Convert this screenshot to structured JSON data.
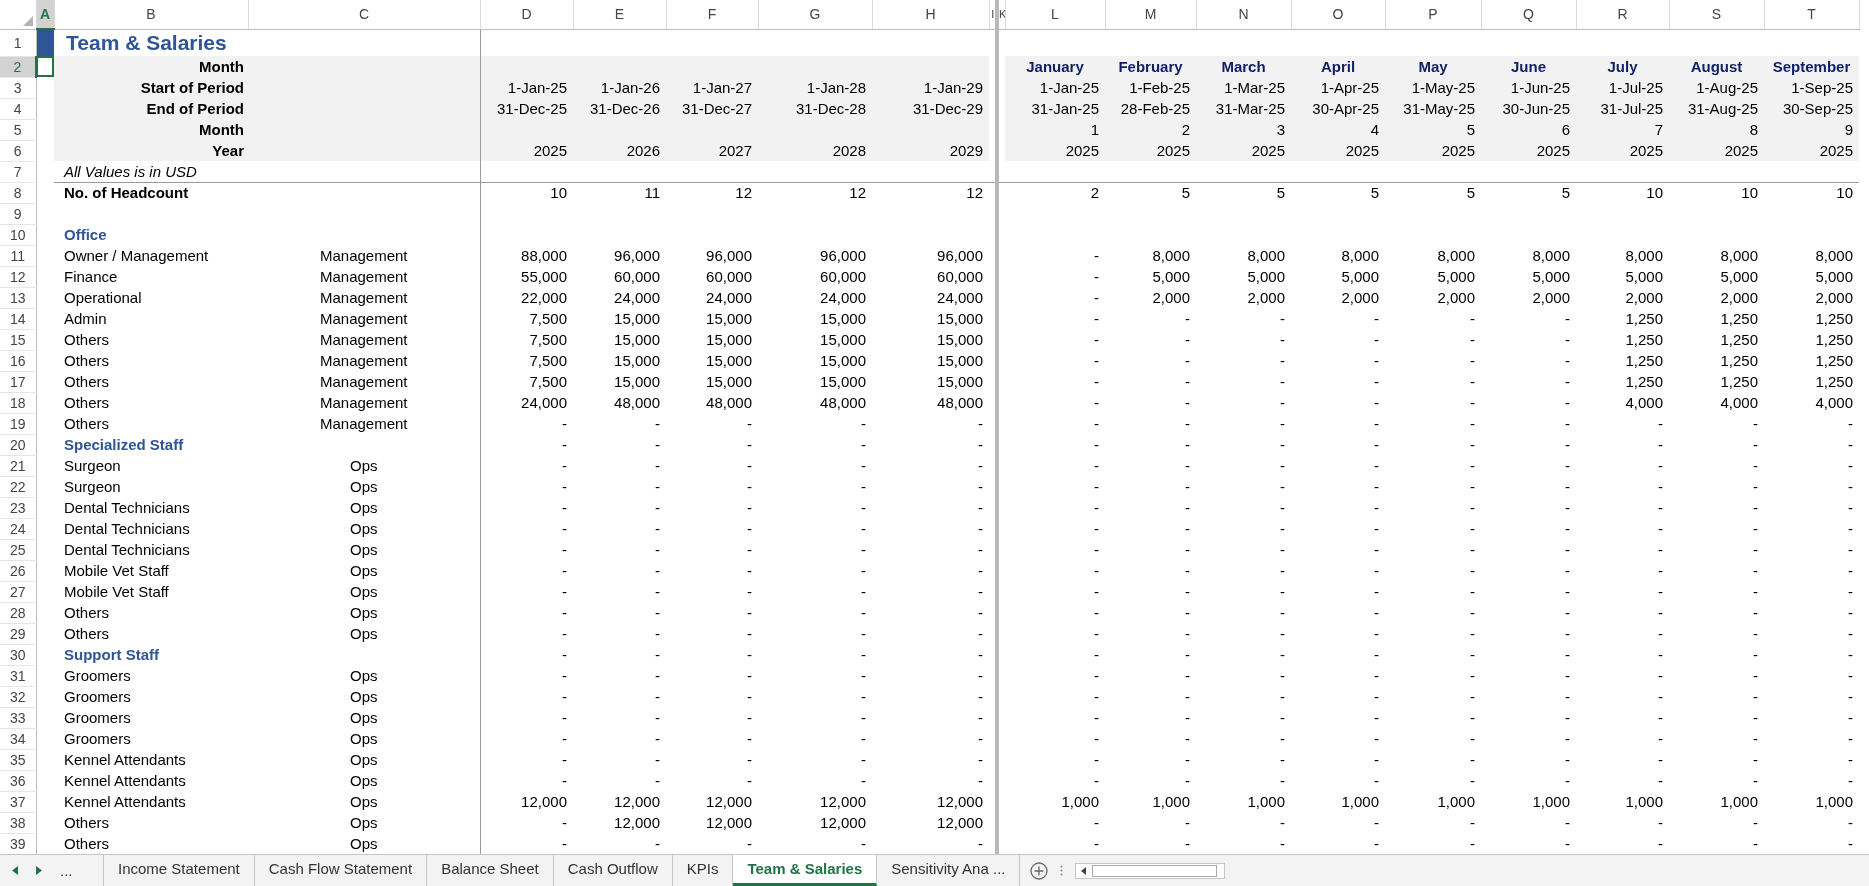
{
  "columns": [
    {
      "letter": "A",
      "selected": true
    },
    {
      "letter": "B",
      "selected": false
    },
    {
      "letter": "C",
      "selected": false
    },
    {
      "letter": "D",
      "selected": false
    },
    {
      "letter": "E",
      "selected": false
    },
    {
      "letter": "F",
      "selected": false
    },
    {
      "letter": "G",
      "selected": false
    },
    {
      "letter": "H",
      "selected": false
    },
    {
      "letter": "I",
      "selected": false
    },
    {
      "letter": "K",
      "selected": false
    },
    {
      "letter": "L",
      "selected": false
    },
    {
      "letter": "M",
      "selected": false
    },
    {
      "letter": "N",
      "selected": false
    },
    {
      "letter": "O",
      "selected": false
    },
    {
      "letter": "P",
      "selected": false
    },
    {
      "letter": "Q",
      "selected": false
    },
    {
      "letter": "R",
      "selected": false
    },
    {
      "letter": "S",
      "selected": false
    },
    {
      "letter": "T",
      "selected": false
    }
  ],
  "rows": [
    {
      "num": "1",
      "kind": "title",
      "selected": false,
      "b": "Team & Salaries"
    },
    {
      "num": "2",
      "kind": "period_names",
      "selected": true,
      "b": "Month",
      "monthly": [
        "January",
        "February",
        "March",
        "April",
        "May",
        "June",
        "July",
        "August",
        "September"
      ]
    },
    {
      "num": "3",
      "kind": "period",
      "selected": false,
      "b": "Start of Period",
      "annual": [
        "1-Jan-25",
        "1-Jan-26",
        "1-Jan-27",
        "1-Jan-28",
        "1-Jan-29"
      ],
      "monthly": [
        "1-Jan-25",
        "1-Feb-25",
        "1-Mar-25",
        "1-Apr-25",
        "1-May-25",
        "1-Jun-25",
        "1-Jul-25",
        "1-Aug-25",
        "1-Sep-25"
      ]
    },
    {
      "num": "4",
      "kind": "period",
      "selected": false,
      "b": "End of Period",
      "annual": [
        "31-Dec-25",
        "31-Dec-26",
        "31-Dec-27",
        "31-Dec-28",
        "31-Dec-29"
      ],
      "monthly": [
        "31-Jan-25",
        "28-Feb-25",
        "31-Mar-25",
        "30-Apr-25",
        "31-May-25",
        "30-Jun-25",
        "31-Jul-25",
        "31-Aug-25",
        "30-Sep-25"
      ]
    },
    {
      "num": "5",
      "kind": "period",
      "selected": false,
      "b": "Month",
      "monthly": [
        "1",
        "2",
        "3",
        "4",
        "5",
        "6",
        "7",
        "8",
        "9"
      ]
    },
    {
      "num": "6",
      "kind": "period",
      "selected": false,
      "b": "Year",
      "annual": [
        "2025",
        "2026",
        "2027",
        "2028",
        "2029"
      ],
      "monthly": [
        "2025",
        "2025",
        "2025",
        "2025",
        "2025",
        "2025",
        "2025",
        "2025",
        "2025"
      ]
    },
    {
      "num": "7",
      "kind": "note",
      "selected": false,
      "b": "All Values is in USD"
    },
    {
      "num": "8",
      "kind": "total",
      "selected": false,
      "b": "No. of Headcount",
      "annual": [
        "10",
        "11",
        "12",
        "12",
        "12"
      ],
      "monthly": [
        "2",
        "5",
        "5",
        "5",
        "5",
        "5",
        "10",
        "10",
        "10"
      ]
    },
    {
      "num": "9",
      "kind": "blank",
      "selected": false
    },
    {
      "num": "10",
      "kind": "section",
      "selected": false,
      "b": "Office"
    },
    {
      "num": "11",
      "kind": "item",
      "selected": false,
      "b": "Owner / Management",
      "c": "Management",
      "annual": [
        "88,000",
        "96,000",
        "96,000",
        "96,000",
        "96,000"
      ],
      "monthly": [
        "-",
        "8,000",
        "8,000",
        "8,000",
        "8,000",
        "8,000",
        "8,000",
        "8,000",
        "8,000"
      ]
    },
    {
      "num": "12",
      "kind": "item",
      "selected": false,
      "b": "Finance",
      "c": "Management",
      "annual": [
        "55,000",
        "60,000",
        "60,000",
        "60,000",
        "60,000"
      ],
      "monthly": [
        "-",
        "5,000",
        "5,000",
        "5,000",
        "5,000",
        "5,000",
        "5,000",
        "5,000",
        "5,000"
      ]
    },
    {
      "num": "13",
      "kind": "item",
      "selected": false,
      "b": "Operational",
      "c": "Management",
      "annual": [
        "22,000",
        "24,000",
        "24,000",
        "24,000",
        "24,000"
      ],
      "monthly": [
        "-",
        "2,000",
        "2,000",
        "2,000",
        "2,000",
        "2,000",
        "2,000",
        "2,000",
        "2,000"
      ]
    },
    {
      "num": "14",
      "kind": "item",
      "selected": false,
      "b": "Admin",
      "c": "Management",
      "annual": [
        "7,500",
        "15,000",
        "15,000",
        "15,000",
        "15,000"
      ],
      "monthly": [
        "-",
        "-",
        "-",
        "-",
        "-",
        "-",
        "1,250",
        "1,250",
        "1,250"
      ]
    },
    {
      "num": "15",
      "kind": "item",
      "selected": false,
      "b": "Others",
      "c": "Management",
      "annual": [
        "7,500",
        "15,000",
        "15,000",
        "15,000",
        "15,000"
      ],
      "monthly": [
        "-",
        "-",
        "-",
        "-",
        "-",
        "-",
        "1,250",
        "1,250",
        "1,250"
      ]
    },
    {
      "num": "16",
      "kind": "item",
      "selected": false,
      "b": "Others",
      "c": "Management",
      "annual": [
        "7,500",
        "15,000",
        "15,000",
        "15,000",
        "15,000"
      ],
      "monthly": [
        "-",
        "-",
        "-",
        "-",
        "-",
        "-",
        "1,250",
        "1,250",
        "1,250"
      ]
    },
    {
      "num": "17",
      "kind": "item",
      "selected": false,
      "b": "Others",
      "c": "Management",
      "annual": [
        "7,500",
        "15,000",
        "15,000",
        "15,000",
        "15,000"
      ],
      "monthly": [
        "-",
        "-",
        "-",
        "-",
        "-",
        "-",
        "1,250",
        "1,250",
        "1,250"
      ]
    },
    {
      "num": "18",
      "kind": "item",
      "selected": false,
      "b": "Others",
      "c": "Management",
      "annual": [
        "24,000",
        "48,000",
        "48,000",
        "48,000",
        "48,000"
      ],
      "monthly": [
        "-",
        "-",
        "-",
        "-",
        "-",
        "-",
        "4,000",
        "4,000",
        "4,000"
      ]
    },
    {
      "num": "19",
      "kind": "item",
      "selected": false,
      "b": "Others",
      "c": "Management",
      "annual": [
        "-",
        "-",
        "-",
        "-",
        "-"
      ],
      "monthly": [
        "-",
        "-",
        "-",
        "-",
        "-",
        "-",
        "-",
        "-",
        "-"
      ]
    },
    {
      "num": "20",
      "kind": "section",
      "selected": false,
      "b": "Specialized Staff",
      "annual": [
        "-",
        "-",
        "-",
        "-",
        "-"
      ],
      "monthly": [
        "-",
        "-",
        "-",
        "-",
        "-",
        "-",
        "-",
        "-",
        "-"
      ]
    },
    {
      "num": "21",
      "kind": "item",
      "selected": false,
      "b": "Surgeon",
      "c": "Ops",
      "annual": [
        "-",
        "-",
        "-",
        "-",
        "-"
      ],
      "monthly": [
        "-",
        "-",
        "-",
        "-",
        "-",
        "-",
        "-",
        "-",
        "-"
      ]
    },
    {
      "num": "22",
      "kind": "item",
      "selected": false,
      "b": "Surgeon",
      "c": "Ops",
      "annual": [
        "-",
        "-",
        "-",
        "-",
        "-"
      ],
      "monthly": [
        "-",
        "-",
        "-",
        "-",
        "-",
        "-",
        "-",
        "-",
        "-"
      ]
    },
    {
      "num": "23",
      "kind": "item",
      "selected": false,
      "b": "Dental Technicians",
      "c": "Ops",
      "annual": [
        "-",
        "-",
        "-",
        "-",
        "-"
      ],
      "monthly": [
        "-",
        "-",
        "-",
        "-",
        "-",
        "-",
        "-",
        "-",
        "-"
      ]
    },
    {
      "num": "24",
      "kind": "item",
      "selected": false,
      "b": "Dental Technicians",
      "c": "Ops",
      "annual": [
        "-",
        "-",
        "-",
        "-",
        "-"
      ],
      "monthly": [
        "-",
        "-",
        "-",
        "-",
        "-",
        "-",
        "-",
        "-",
        "-"
      ]
    },
    {
      "num": "25",
      "kind": "item",
      "selected": false,
      "b": "Dental Technicians",
      "c": "Ops",
      "annual": [
        "-",
        "-",
        "-",
        "-",
        "-"
      ],
      "monthly": [
        "-",
        "-",
        "-",
        "-",
        "-",
        "-",
        "-",
        "-",
        "-"
      ]
    },
    {
      "num": "26",
      "kind": "item",
      "selected": false,
      "b": "Mobile Vet Staff",
      "c": "Ops",
      "annual": [
        "-",
        "-",
        "-",
        "-",
        "-"
      ],
      "monthly": [
        "-",
        "-",
        "-",
        "-",
        "-",
        "-",
        "-",
        "-",
        "-"
      ]
    },
    {
      "num": "27",
      "kind": "item",
      "selected": false,
      "b": "Mobile Vet Staff",
      "c": "Ops",
      "annual": [
        "-",
        "-",
        "-",
        "-",
        "-"
      ],
      "monthly": [
        "-",
        "-",
        "-",
        "-",
        "-",
        "-",
        "-",
        "-",
        "-"
      ]
    },
    {
      "num": "28",
      "kind": "item",
      "selected": false,
      "b": "Others",
      "c": "Ops",
      "annual": [
        "-",
        "-",
        "-",
        "-",
        "-"
      ],
      "monthly": [
        "-",
        "-",
        "-",
        "-",
        "-",
        "-",
        "-",
        "-",
        "-"
      ]
    },
    {
      "num": "29",
      "kind": "item",
      "selected": false,
      "b": "Others",
      "c": "Ops",
      "annual": [
        "-",
        "-",
        "-",
        "-",
        "-"
      ],
      "monthly": [
        "-",
        "-",
        "-",
        "-",
        "-",
        "-",
        "-",
        "-",
        "-"
      ]
    },
    {
      "num": "30",
      "kind": "section",
      "selected": false,
      "b": "Support Staff",
      "annual": [
        "-",
        "-",
        "-",
        "-",
        "-"
      ],
      "monthly": [
        "-",
        "-",
        "-",
        "-",
        "-",
        "-",
        "-",
        "-",
        "-"
      ]
    },
    {
      "num": "31",
      "kind": "item",
      "selected": false,
      "b": "Groomers",
      "c": "Ops",
      "annual": [
        "-",
        "-",
        "-",
        "-",
        "-"
      ],
      "monthly": [
        "-",
        "-",
        "-",
        "-",
        "-",
        "-",
        "-",
        "-",
        "-"
      ]
    },
    {
      "num": "32",
      "kind": "item",
      "selected": false,
      "b": "Groomers",
      "c": "Ops",
      "annual": [
        "-",
        "-",
        "-",
        "-",
        "-"
      ],
      "monthly": [
        "-",
        "-",
        "-",
        "-",
        "-",
        "-",
        "-",
        "-",
        "-"
      ]
    },
    {
      "num": "33",
      "kind": "item",
      "selected": false,
      "b": "Groomers",
      "c": "Ops",
      "annual": [
        "-",
        "-",
        "-",
        "-",
        "-"
      ],
      "monthly": [
        "-",
        "-",
        "-",
        "-",
        "-",
        "-",
        "-",
        "-",
        "-"
      ]
    },
    {
      "num": "34",
      "kind": "item",
      "selected": false,
      "b": "Groomers",
      "c": "Ops",
      "annual": [
        "-",
        "-",
        "-",
        "-",
        "-"
      ],
      "monthly": [
        "-",
        "-",
        "-",
        "-",
        "-",
        "-",
        "-",
        "-",
        "-"
      ]
    },
    {
      "num": "35",
      "kind": "item",
      "selected": false,
      "b": "Kennel Attendants",
      "c": "Ops",
      "annual": [
        "-",
        "-",
        "-",
        "-",
        "-"
      ],
      "monthly": [
        "-",
        "-",
        "-",
        "-",
        "-",
        "-",
        "-",
        "-",
        "-"
      ]
    },
    {
      "num": "36",
      "kind": "item",
      "selected": false,
      "b": "Kennel Attendants",
      "c": "Ops",
      "annual": [
        "-",
        "-",
        "-",
        "-",
        "-"
      ],
      "monthly": [
        "-",
        "-",
        "-",
        "-",
        "-",
        "-",
        "-",
        "-",
        "-"
      ]
    },
    {
      "num": "37",
      "kind": "item",
      "selected": false,
      "b": "Kennel Attendants",
      "c": "Ops",
      "annual": [
        "12,000",
        "12,000",
        "12,000",
        "12,000",
        "12,000"
      ],
      "monthly": [
        "1,000",
        "1,000",
        "1,000",
        "1,000",
        "1,000",
        "1,000",
        "1,000",
        "1,000",
        "1,000"
      ]
    },
    {
      "num": "38",
      "kind": "item",
      "selected": false,
      "b": "Others",
      "c": "Ops",
      "annual": [
        "-",
        "12,000",
        "12,000",
        "12,000",
        "12,000"
      ],
      "monthly": [
        "-",
        "-",
        "-",
        "-",
        "-",
        "-",
        "-",
        "-",
        "-"
      ]
    },
    {
      "num": "39",
      "kind": "item",
      "selected": false,
      "b": "Others",
      "c": "Ops",
      "annual": [
        "-",
        "-",
        "-",
        "-",
        "-"
      ],
      "monthly": [
        "-",
        "-",
        "-",
        "-",
        "-",
        "-",
        "-",
        "-",
        "-"
      ]
    }
  ],
  "sheet_tabs": {
    "overflow": "...",
    "tabs": [
      {
        "label": "Income Statement",
        "selected": false
      },
      {
        "label": "Cash Flow Statement",
        "selected": false
      },
      {
        "label": "Balance Sheet",
        "selected": false
      },
      {
        "label": "Cash Outflow",
        "selected": false
      },
      {
        "label": "KPIs",
        "selected": false
      },
      {
        "label": "Team & Salaries",
        "selected": true
      },
      {
        "label": "Sensitivity Ana ...",
        "selected": false
      }
    ]
  }
}
